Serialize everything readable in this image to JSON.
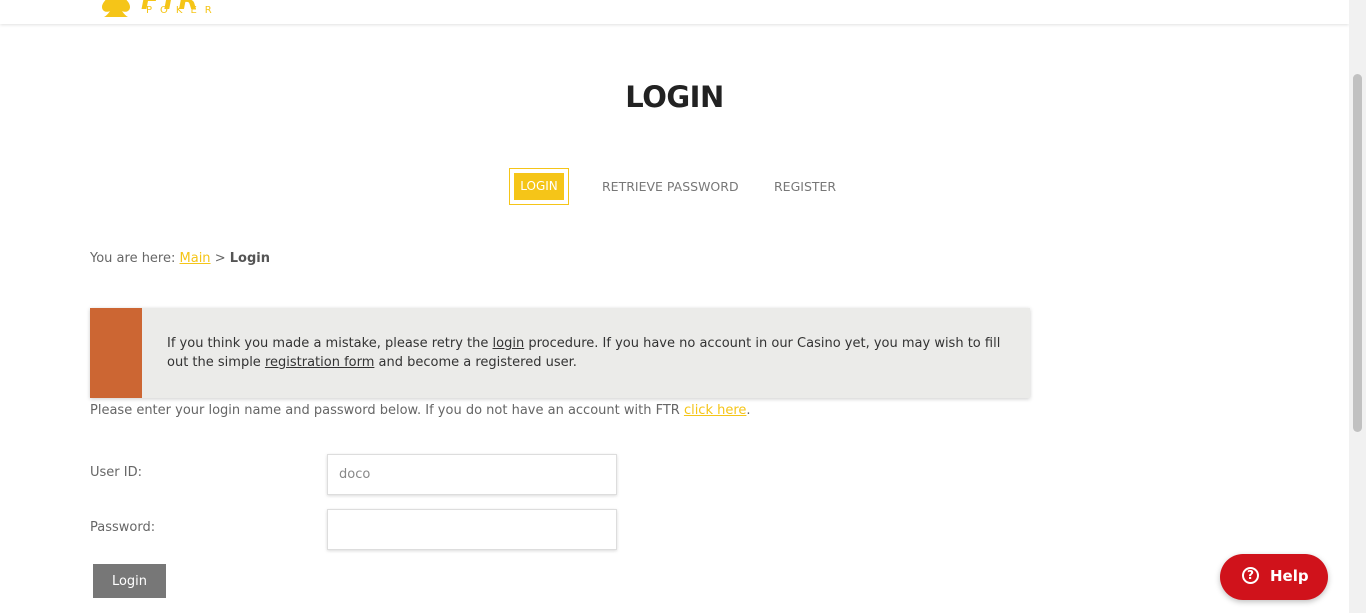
{
  "header": {
    "logo_text": "FTR",
    "logo_sub": "POKER"
  },
  "page_title": "LOGIN",
  "tabs": [
    {
      "label": "LOGIN",
      "active": true
    },
    {
      "label": "RETRIEVE PASSWORD",
      "active": false
    },
    {
      "label": "REGISTER",
      "active": false
    }
  ],
  "breadcrumb": {
    "prefix": "You are here:",
    "main_link": "Main",
    "separator": ">",
    "current": "Login"
  },
  "notice": {
    "part1": "If you think you made a mistake, please retry the ",
    "login_link": "login",
    "part2": " procedure. If you have no account in our Casino yet, you may wish to fill out the simple ",
    "registration_link": "registration form",
    "part3": " and become a registered user."
  },
  "intro": {
    "text": "Please enter your login name and password below. If you do not have an account with FTR ",
    "link": "click here",
    "end": "."
  },
  "form": {
    "user_label": "User ID:",
    "user_value": "doco",
    "password_label": "Password:",
    "password_value": "",
    "submit_label": "Login"
  },
  "help": {
    "label": "Help"
  },
  "colors": {
    "accent": "#f5c518",
    "notice_bar": "#cc6633",
    "help_button": "#d0121b",
    "login_button": "#777777"
  }
}
